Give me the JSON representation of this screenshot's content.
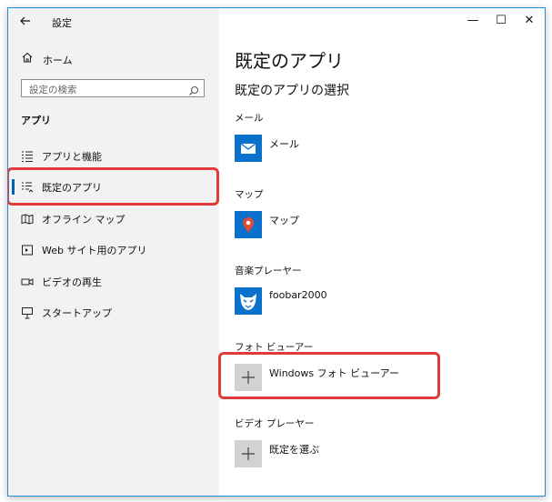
{
  "window": {
    "title": "設定",
    "controls": {
      "minimize": "—",
      "maximize": "☐",
      "close": "✕"
    }
  },
  "sidebar": {
    "home_label": "ホーム",
    "search_placeholder": "設定の検索",
    "section_heading": "アプリ",
    "items": [
      {
        "label": "アプリと機能",
        "icon": "list-icon",
        "selected": false
      },
      {
        "label": "既定のアプリ",
        "icon": "default-apps-icon",
        "selected": true
      },
      {
        "label": "オフライン マップ",
        "icon": "offline-map-icon",
        "selected": false
      },
      {
        "label": "Web サイト用のアプリ",
        "icon": "website-app-icon",
        "selected": false
      },
      {
        "label": "ビデオの再生",
        "icon": "video-icon",
        "selected": false
      },
      {
        "label": "スタートアップ",
        "icon": "startup-icon",
        "selected": false
      }
    ]
  },
  "main": {
    "title": "既定のアプリ",
    "subheading": "既定のアプリの選択",
    "categories": [
      {
        "label": "メール",
        "app": "メール",
        "icon": "mail-icon"
      },
      {
        "label": "マップ",
        "app": "マップ",
        "icon": "maps-icon"
      },
      {
        "label": "音楽プレーヤー",
        "app": "foobar2000",
        "icon": "foobar-icon"
      },
      {
        "label": "フォト ビューアー",
        "app": "Windows フォト ビューアー",
        "icon": "plus-icon"
      },
      {
        "label": "ビデオ プレーヤー",
        "app": "既定を選ぶ",
        "icon": "plus-icon"
      }
    ]
  },
  "colors": {
    "accent": "#0063b1",
    "tile_blue": "#0a72cc",
    "highlight_red": "#e03a3a",
    "sidebar_bg": "#f2f2f2"
  }
}
